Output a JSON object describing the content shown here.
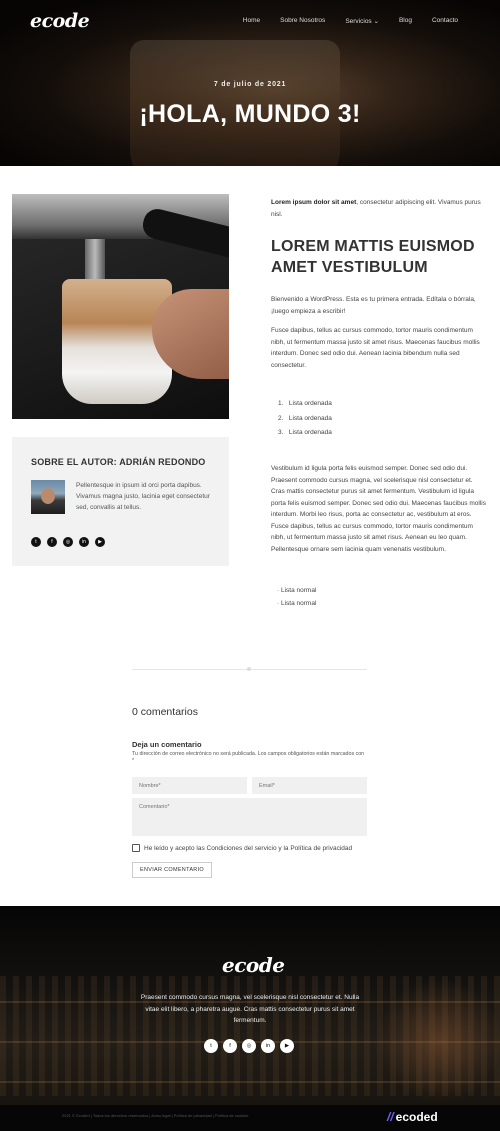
{
  "header": {
    "logo": "ecode",
    "nav": [
      "Home",
      "Sobre Nosotros",
      "Servicios",
      "Blog",
      "Contacto"
    ],
    "date": "7 de julio de 2021",
    "title": "¡HOLA, MUNDO 3!"
  },
  "author": {
    "heading": "SOBRE EL AUTOR: ADRIÁN REDONDO",
    "bio": "Pellentesque in ipsum id orci porta dapibus. Vivamus magna justo, lacinia eget consectetur sed, convallis at tellus.",
    "socials": [
      "twitter-icon",
      "facebook-icon",
      "instagram-icon",
      "linkedin-icon",
      "youtube-icon"
    ]
  },
  "article": {
    "lead_bold": "Lorem ipsum dolor sit amet",
    "lead_rest": ", consectetur adipiscing elit. Vivamus purus nisl.",
    "heading": "LOREM MATTIS EUISMOD AMET VESTIBULUM",
    "p1": "Bienvenido a WordPress. Esta es tu primera entrada. Edítala o bórrala, ¡luego empieza a escribir!",
    "p2": "Fusce dapibus, tellus ac cursus commodo, tortor mauris condimentum nibh, ut fermentum massa justo sit amet risus. Maecenas faucibus mollis interdum. Donec sed odio dui. Aenean lacinia bibendum nulla sed consectetur.",
    "ordered": [
      "Lista ordenada",
      "Lista ordenada",
      "Lista ordenada"
    ],
    "p3": "Vestibulum id ligula porta felis euismod semper. Donec sed odio dui. Praesent commodo cursus magna, vel scelerisque nisl consectetur et. Cras mattis consectetur purus sit amet fermentum. Vestibulum id ligula porta felis euismod semper. Donec sed odio dui. Maecenas faucibus mollis interdum. Morbi leo risus, porta ac consectetur ac, vestibulum at eros. Fusce dapibus, tellus ac cursus commodo, tortor mauris condimentum nibh, ut fermentum massa justo sit amet risus. Aenean eu leo quam. Pellentesque ornare sem lacinia quam venenatis vestibulum.",
    "unordered": [
      "Lista normal",
      "Lista normal"
    ]
  },
  "comments": {
    "count": "0 comentarios",
    "leave": "Deja un comentario",
    "note": "Tu dirección de correo electrónico no será publicada. Los campos obligatorios están marcados con *",
    "name_placeholder": "Nombre*",
    "email_placeholder": "Email*",
    "comment_placeholder": "Comentario*",
    "consent": "He leído y acepto las Condiciones del servicio y la Política de privacidad",
    "submit": "ENVIAR COMENTARIO"
  },
  "footer": {
    "logo": "ecode",
    "text": "Praesent commodo cursus magna, vel scelerisque nisl consectetur et. Nulla vitae elit libero, a pharetra augue. Cras mattis consectetur purus sit amet fermentum.",
    "socials": [
      "twitter-icon",
      "facebook-icon",
      "instagram-icon",
      "linkedin-icon",
      "youtube-icon"
    ],
    "copyright": "2021 © Ecoded | Todos los derechos reservados | Aviso legal | Política de privacidad | Política de cookies",
    "brand": "ecoded"
  }
}
